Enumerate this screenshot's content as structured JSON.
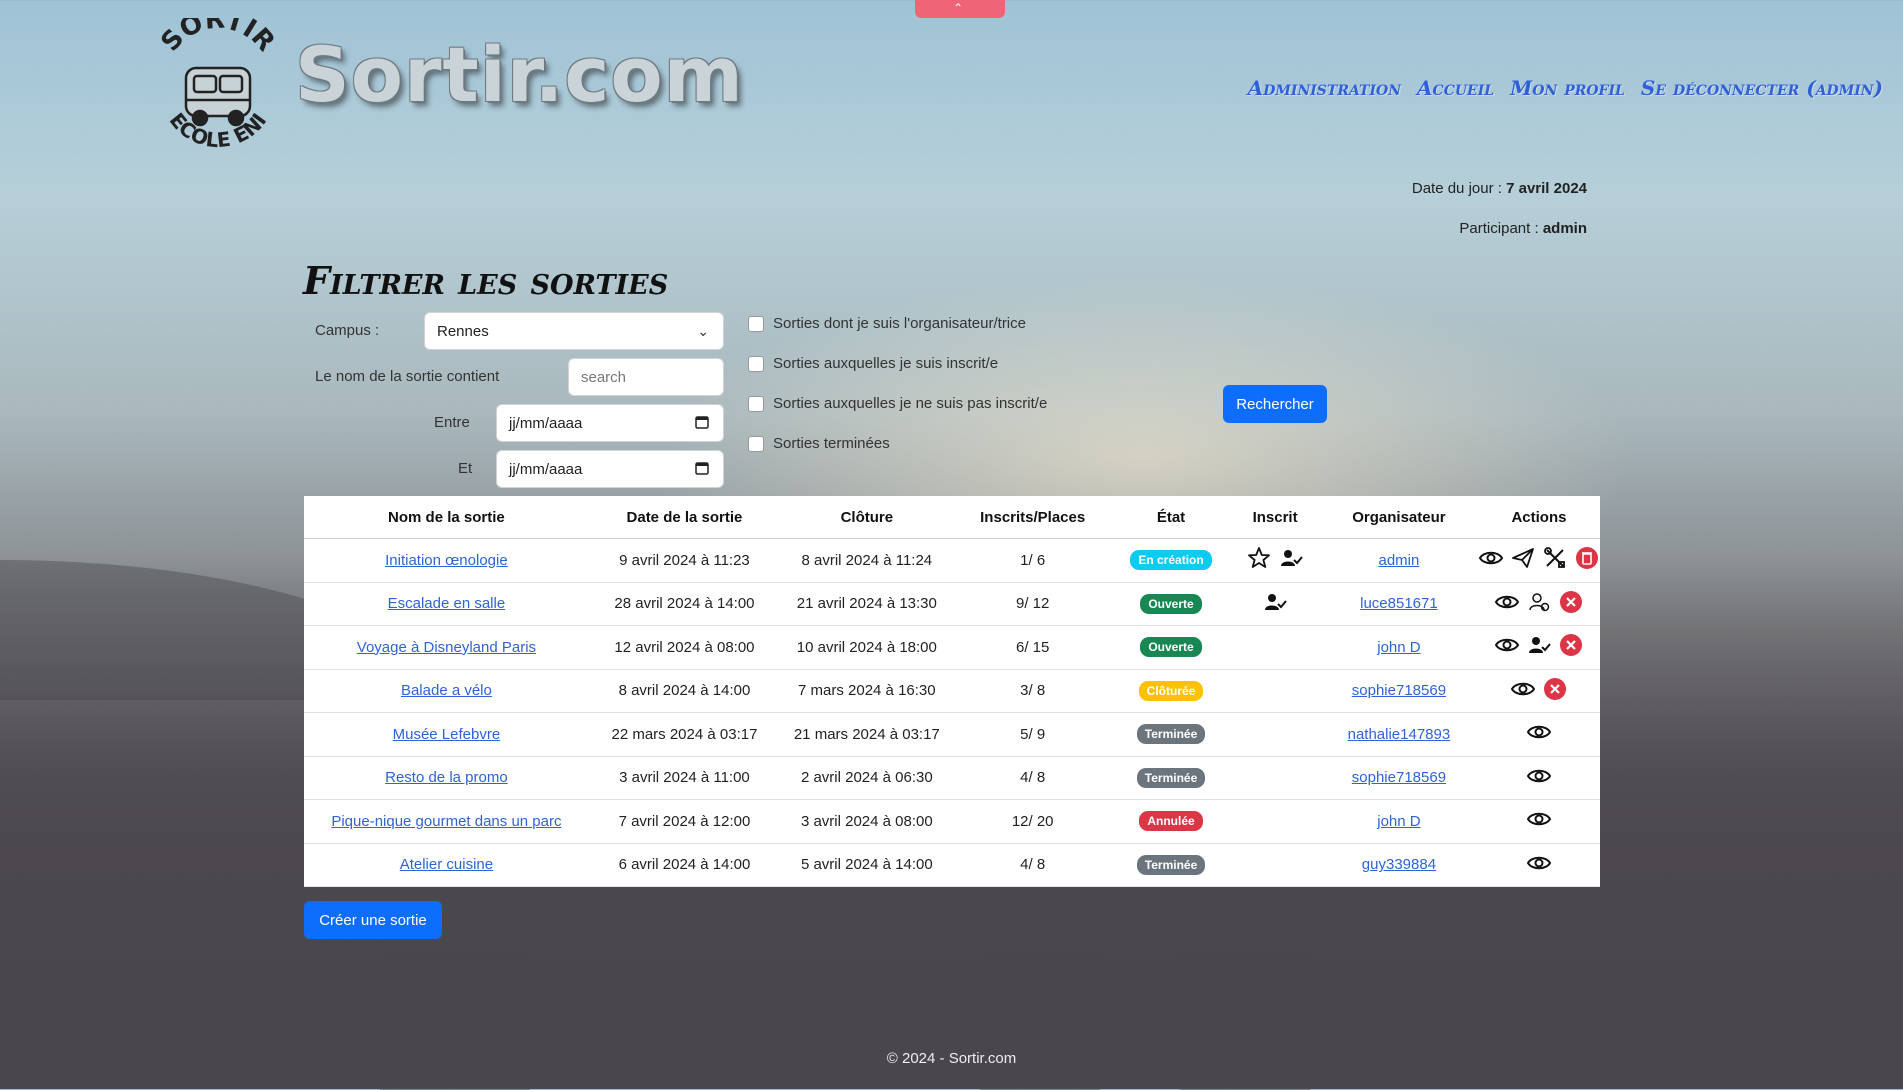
{
  "brand": "Sortir.com",
  "logo": {
    "top_text": "SORTIR",
    "bottom_text": "ECOLE ENI"
  },
  "nav": [
    {
      "label": "Administration"
    },
    {
      "label": "Accueil"
    },
    {
      "label": "Mon profil"
    },
    {
      "label": "Se déconnecter (admin)"
    }
  ],
  "info": {
    "date_label": "Date du jour :",
    "date_value": "7 avril 2024",
    "participant_label": "Participant :",
    "participant_value": "admin"
  },
  "filter": {
    "title": "Filtrer les sorties",
    "campus_label": "Campus :",
    "campus_value": "Rennes",
    "name_label": "Le nom de la sortie contient",
    "search_placeholder": "search",
    "between_label": "Entre",
    "and_label": "Et",
    "date_placeholder": "jj/mm/aaaa",
    "checkboxes": [
      "Sorties dont je suis l'organisateur/trice",
      "Sorties auxquelles je suis inscrit/e",
      "Sorties auxquelles je ne suis pas inscrit/e",
      "Sorties terminées"
    ],
    "search_button": "Rechercher"
  },
  "table": {
    "headers": [
      "Nom de la sortie",
      "Date de la sortie",
      "Clôture",
      "Inscrits/Places",
      "État",
      "Inscrit",
      "Organisateur",
      "Actions"
    ],
    "rows": [
      {
        "name": "Initiation œnologie",
        "date": "9 avril 2024 à 11:23",
        "cloture": "8 avril 2024 à 11:24",
        "places": "1/ 6",
        "etat": "En création",
        "etat_color": "#0dcaf0",
        "inscrit": [
          "star-icon",
          "user-check-icon"
        ],
        "org": "admin",
        "actions": [
          "eye-icon",
          "send-icon",
          "tools-icon",
          "trash-icon"
        ]
      },
      {
        "name": "Escalade en salle",
        "date": "28 avril 2024 à 14:00",
        "cloture": "21 avril 2024 à 13:30",
        "places": "9/ 12",
        "etat": "Ouverte",
        "etat_color": "#198754",
        "inscrit": [
          "user-check-icon"
        ],
        "org": "luce851671",
        "actions": [
          "eye-icon",
          "user-add-icon",
          "cancel-icon"
        ]
      },
      {
        "name": "Voyage à Disneyland Paris",
        "date": "12 avril 2024 à 08:00",
        "cloture": "10 avril 2024 à 18:00",
        "places": "6/ 15",
        "etat": "Ouverte",
        "etat_color": "#198754",
        "inscrit": [],
        "org": "john D",
        "actions": [
          "eye-icon",
          "user-check-icon",
          "cancel-icon"
        ]
      },
      {
        "name": "Balade a vélo",
        "date": "8 avril 2024 à 14:00",
        "cloture": "7 mars 2024 à 16:30",
        "places": "3/ 8",
        "etat": "Clôturée",
        "etat_color": "#ffc107",
        "inscrit": [],
        "org": "sophie718569",
        "actions": [
          "eye-icon",
          "cancel-icon"
        ]
      },
      {
        "name": "Musée Lefebvre",
        "date": "22 mars 2024 à 03:17",
        "cloture": "21 mars 2024 à 03:17",
        "places": "5/ 9",
        "etat": "Terminée",
        "etat_color": "#6c757d",
        "inscrit": [],
        "org": "nathalie147893",
        "actions": [
          "eye-icon"
        ]
      },
      {
        "name": "Resto de la promo",
        "date": "3 avril 2024 à 11:00",
        "cloture": "2 avril 2024 à 06:30",
        "places": "4/ 8",
        "etat": "Terminée",
        "etat_color": "#6c757d",
        "inscrit": [],
        "org": "sophie718569",
        "actions": [
          "eye-icon"
        ]
      },
      {
        "name": "Pique-nique gourmet dans un parc",
        "date": "7 avril 2024 à 12:00",
        "cloture": "3 avril 2024 à 08:00",
        "places": "12/ 20",
        "etat": "Annulée",
        "etat_color": "#dc3545",
        "inscrit": [],
        "org": "john D",
        "actions": [
          "eye-icon"
        ]
      },
      {
        "name": "Atelier cuisine",
        "date": "6 avril 2024 à 14:00",
        "cloture": "5 avril 2024 à 14:00",
        "places": "4/ 8",
        "etat": "Terminée",
        "etat_color": "#6c757d",
        "inscrit": [],
        "org": "guy339884",
        "actions": [
          "eye-icon"
        ]
      }
    ]
  },
  "create_button": "Créer une sortie",
  "footer": "© 2024 - Sortir.com"
}
